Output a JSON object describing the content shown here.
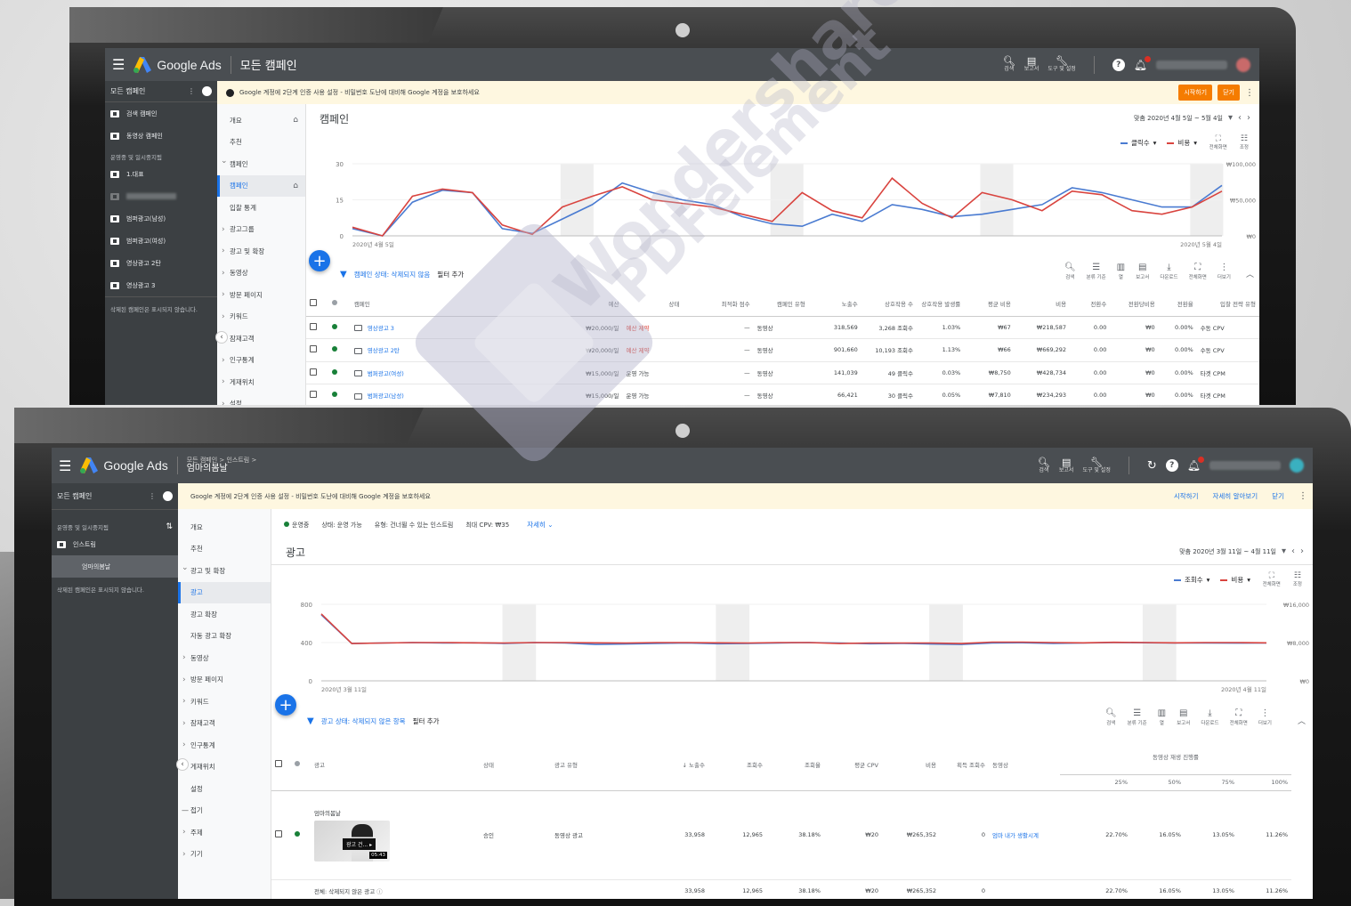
{
  "s1": {
    "brand": "Google Ads",
    "title": "모든 캠페인",
    "toolbar": {
      "search": "검색",
      "reports": "보고서",
      "tools": "도구 및 설정"
    },
    "nav_header": "모든 캠페인",
    "nav_items": [
      {
        "label": "검색 캠페인"
      },
      {
        "label": "동영상 캠페인"
      }
    ],
    "nav_section": "운영중 및 일시중지됨",
    "nav_items2": [
      {
        "label": "1.대표"
      },
      {
        "label": "범퍼광고(남성)"
      },
      {
        "label": "범퍼광고(여성)"
      },
      {
        "label": "영상광고 2탄"
      },
      {
        "label": "영상광고 3"
      }
    ],
    "nav_note": "삭제된 캠페인은 표시되지 않습니다.",
    "banner": {
      "text": "Google 계정에 2단계 인증 사용 설정 - 비밀번호 도난에 대비해 Google 계정을 보호하세요",
      "start": "시작하기",
      "close": "닫기"
    },
    "subnav": [
      "개요",
      "추천",
      "캠페인",
      "캠페인",
      "입찰 통계",
      "광고그룹",
      "광고 및 확장",
      "동영상",
      "방문 페이지",
      "키워드",
      "잠재고객",
      "인구통계",
      "게재위치",
      "설정"
    ],
    "page_title": "캠페인",
    "date_range": "맞춤   2020년 4월 5일 ~ 5월 4일",
    "metrics": [
      "클릭수",
      "비용"
    ],
    "chart_tools": [
      "전체화면",
      "조정"
    ],
    "chart_data": {
      "type": "line",
      "title": "",
      "x": [
        "2020년 4월 5일",
        "",
        "",
        "",
        "",
        "",
        "",
        "",
        "",
        "",
        "",
        "",
        "",
        "",
        "",
        "",
        "",
        "",
        "",
        "",
        "",
        "",
        "",
        "",
        "",
        "",
        "",
        "",
        "",
        "2020년 5월 4일"
      ],
      "y_left": {
        "ticks": [
          "0",
          "15",
          "30"
        ],
        "ylim": [
          0,
          30
        ]
      },
      "y_right": {
        "ticks": [
          "₩0",
          "₩50,000",
          "₩100,000"
        ],
        "ylim": [
          0,
          100000
        ]
      },
      "series": [
        {
          "name": "클릭수",
          "axis": "left",
          "color": "#4a7bd1",
          "values": [
            3,
            0,
            14,
            19,
            18,
            3,
            1,
            7,
            13,
            22,
            18,
            15,
            13,
            8,
            5,
            4,
            9,
            6,
            13,
            11,
            8,
            9,
            11,
            13,
            20,
            18,
            15,
            12,
            12,
            21
          ]
        },
        {
          "name": "비용",
          "axis": "right",
          "color": "#d9443f",
          "values": [
            12000,
            0,
            55000,
            65000,
            60000,
            15000,
            2000,
            40000,
            55000,
            68000,
            50000,
            45000,
            40000,
            30000,
            20000,
            60000,
            35000,
            25000,
            80000,
            45000,
            25000,
            60000,
            50000,
            35000,
            62000,
            57000,
            35000,
            30000,
            40000,
            62000
          ]
        }
      ]
    },
    "filter": {
      "label": "캠페인 상태: 삭제되지 않음",
      "add": "필터 추가"
    },
    "tools": [
      "검색",
      "분류 기준",
      "열",
      "보고서",
      "다운로드",
      "전체화면",
      "더보기"
    ],
    "table": {
      "headers": [
        "캠페인",
        "예산",
        "상태",
        "최적화 점수",
        "캠페인 유형",
        "노출수",
        "상호작용 수",
        "상호작용 발생률",
        "평균 비용",
        "비용",
        "전환수",
        "전환당비용",
        "전환율",
        "입찰 전략 유형"
      ],
      "rows": [
        [
          "영상광고 3",
          "₩20,000/일",
          "예산 제약",
          "—",
          "동영상",
          "318,569",
          "3,268 조회수",
          "1.03%",
          "₩67",
          "₩218,587",
          "0.00",
          "₩0",
          "0.00%",
          "수동 CPV"
        ],
        [
          "영상광고 2탄",
          "₩20,000/일",
          "예산 제약",
          "—",
          "동영상",
          "901,660",
          "10,193 조회수",
          "1.13%",
          "₩66",
          "₩669,292",
          "0.00",
          "₩0",
          "0.00%",
          "수동 CPV"
        ],
        [
          "범퍼광고(여성)",
          "₩15,000/일",
          "운영 가능",
          "—",
          "동영상",
          "141,039",
          "49 클릭수",
          "0.03%",
          "₩8,750",
          "₩428,734",
          "0.00",
          "₩0",
          "0.00%",
          "타겟 CPM"
        ],
        [
          "범퍼광고(남성)",
          "₩15,000/일",
          "운영 가능",
          "—",
          "동영상",
          "66,421",
          "30 클릭수",
          "0.05%",
          "₩7,810",
          "₩234,293",
          "0.00",
          "₩0",
          "0.00%",
          "타겟 CPM"
        ]
      ]
    }
  },
  "s2": {
    "brand": "Google Ads",
    "crumb1": "모든 캠페인  >  인스트림  >",
    "crumb2": "엄마의봄날",
    "toolbar": {
      "search": "검색",
      "reports": "보고서",
      "tools": "도구 및 설정"
    },
    "nav_header": "모든 캠페인",
    "nav_section": "운영중 및 일시중지됨",
    "nav_items": [
      {
        "label": "인스트림"
      },
      {
        "label": "엄마의봄날"
      }
    ],
    "nav_note": "삭제된 캠페인은 표시되지 않습니다.",
    "banner": {
      "text": "Google 계정에 2단계 인증 사용 설정 - 비밀번호 도난에 대비해 Google 계정을 보호하세요",
      "start": "시작하기",
      "learn": "자세히 알아보기",
      "close": "닫기"
    },
    "subnav": [
      "개요",
      "추천",
      "광고 및 확장",
      "광고",
      "광고 확장",
      "자동 광고 확장",
      "동영상",
      "방문 페이지",
      "키워드",
      "잠재고객",
      "인구통계",
      "게재위치",
      "설정",
      "접기",
      "주제",
      "기기"
    ],
    "status": {
      "running": "운영중",
      "state": "상태: 운영 가능",
      "type": "유형: 건너뛸 수 있는 인스트림",
      "cpv": "최대 CPV: ₩35",
      "more": "자세히"
    },
    "page_title": "광고",
    "date_range": "맞춤   2020년 3월 11일 ~ 4월 11일",
    "metrics": [
      "조회수",
      "비용"
    ],
    "chart_tools": [
      "전체화면",
      "조정"
    ],
    "chart_data": {
      "type": "line",
      "title": "",
      "x": [
        "2020년 3월 11일",
        "",
        "",
        "",
        "",
        "",
        "",
        "",
        "",
        "",
        "",
        "",
        "",
        "",
        "",
        "",
        "",
        "",
        "",
        "",
        "",
        "",
        "",
        "",
        "",
        "",
        "",
        "",
        "",
        "",
        "",
        "2020년 4월 11일"
      ],
      "y_left": {
        "ticks": [
          "0",
          "400",
          "800"
        ],
        "ylim": [
          0,
          800
        ]
      },
      "y_right": {
        "ticks": [
          "₩0",
          "₩8,000",
          "₩16,000"
        ],
        "ylim": [
          0,
          16000
        ]
      },
      "series": [
        {
          "name": "조회수",
          "axis": "left",
          "color": "#4a7bd1",
          "values": [
            690,
            390,
            395,
            400,
            395,
            398,
            392,
            400,
            395,
            380,
            385,
            392,
            395,
            388,
            392,
            396,
            400,
            395,
            388,
            392,
            385,
            380,
            395,
            398,
            392,
            395,
            400,
            398,
            395,
            396,
            394,
            395
          ]
        },
        {
          "name": "비용",
          "axis": "right",
          "color": "#d9443f",
          "values": [
            14000,
            7800,
            7900,
            8000,
            8000,
            7950,
            7900,
            8000,
            8000,
            7950,
            7900,
            8000,
            8000,
            7950,
            7900,
            8000,
            8000,
            7800,
            7900,
            7900,
            7900,
            7800,
            8100,
            8100,
            8000,
            7950,
            8050,
            8000,
            7950,
            8000,
            8000,
            7950
          ]
        }
      ]
    },
    "filter": {
      "label": "광고 상태: 삭제되지 않은 항목",
      "add": "필터 추가"
    },
    "tools": [
      "검색",
      "분류 기준",
      "열",
      "보고서",
      "다운로드",
      "전체화면",
      "더보기"
    ],
    "table": {
      "headers": [
        "광고",
        "상태",
        "광고 유형",
        "노출수",
        "조회수",
        "조회율",
        "평균 CPV",
        "비용",
        "획득 조회수",
        "동영상"
      ],
      "group_header": "동영상 재생 진행률",
      "pct_headers": [
        "25%",
        "50%",
        "75%",
        "100%"
      ],
      "ad_name": "엄마의봄날",
      "thumb_title": "광고 건...",
      "thumb_duration": "05:43",
      "row": [
        "승인",
        "동영상 광고",
        "33,958",
        "12,965",
        "38.18%",
        "₩20",
        "₩265,352",
        "0",
        "엄마 내가 생활시계",
        "22.70%",
        "16.05%",
        "13.05%",
        "11.26%"
      ],
      "total1_label": "전체: 삭제되지 않은 광고",
      "total2_label": "총계: 광고그룹",
      "totals": [
        "33,958",
        "12,965",
        "38.18%",
        "₩20",
        "₩265,352",
        "0",
        "22.70%",
        "16.05%",
        "13.05%",
        "11.26%"
      ]
    }
  },
  "watermark": [
    "Wondershare",
    "PDFelement"
  ]
}
